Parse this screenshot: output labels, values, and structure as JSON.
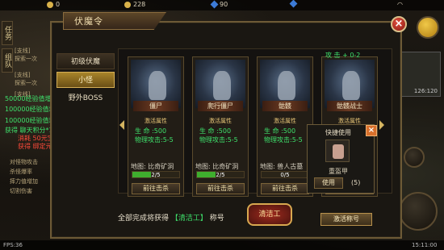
{
  "hud": {
    "gold": "228",
    "diamond": "90",
    "yuanbao": "0",
    "fps": "FPS:36",
    "clock": "15:11:00",
    "mini_time": "126:120",
    "map_label": "比奇矿洞",
    "login_label": "登录"
  },
  "side_tabs": [
    "任务",
    "组队"
  ],
  "side_texts": [
    "[支线]",
    "探索一次",
    "[支线]",
    "探索一次",
    "[支线]"
  ],
  "logs": {
    "green": [
      "50000经验值增加",
      "100000经验值增加",
      "100000经验值增加",
      "获得 聊天积分*1"
    ],
    "red": [
      "消耗 50元宝* 1",
      "获得 绑定元宝* 50"
    ]
  },
  "side_menu": [
    "对怪物攻击",
    "杀怪爆率",
    "摔力值增加",
    "切割伤害"
  ],
  "modal": {
    "title": "伏魔令",
    "close_label": "×",
    "nav": [
      "初级伏魔",
      "小怪",
      "野外BOSS"
    ],
    "attack_bonus": "攻  击 + 0-2",
    "attr_title": "激活属性",
    "cards": [
      {
        "name": "僵尸",
        "hp": "生    命 :500",
        "atk": "物理攻击:5-5",
        "map": "地图: 比奇矿洞",
        "progress_text": "2/5",
        "progress": 0.4,
        "button": "前往击杀"
      },
      {
        "name": "爬行僵尸",
        "hp": "生    命 :500",
        "atk": "物理攻击:5-5",
        "map": "地图: 比奇矿洞",
        "progress_text": "2/5",
        "progress": 0.4,
        "button": "前往击杀"
      },
      {
        "name": "骷髅",
        "hp": "生    命 :500",
        "atk": "物理攻击:5-5",
        "map": "地图: 兽人古墓",
        "progress_text": "0/5",
        "progress": 0.0,
        "button": "前往击杀"
      },
      {
        "name": "骷髅战士",
        "hp": "生    命 :500",
        "atk": "物理攻击:5-5",
        "map": "地图: 兽人古墓",
        "progress_text": "0/5",
        "progress": 0.0,
        "button": "前往击杀"
      }
    ],
    "quick_use": {
      "title": "快捷使用",
      "item_name": "重盔甲",
      "use_label": "使用",
      "count": "(5)"
    },
    "footer": {
      "prefix": "全部完成将获得",
      "reward": "【清洁工】",
      "suffix": "称号"
    },
    "seal_text": "清洁工",
    "activate_label": "激活称号"
  },
  "colors": {
    "accent_gold": "#d4ae56",
    "stat_green": "#3ee06b",
    "warning_red": "#ff4a3a"
  }
}
